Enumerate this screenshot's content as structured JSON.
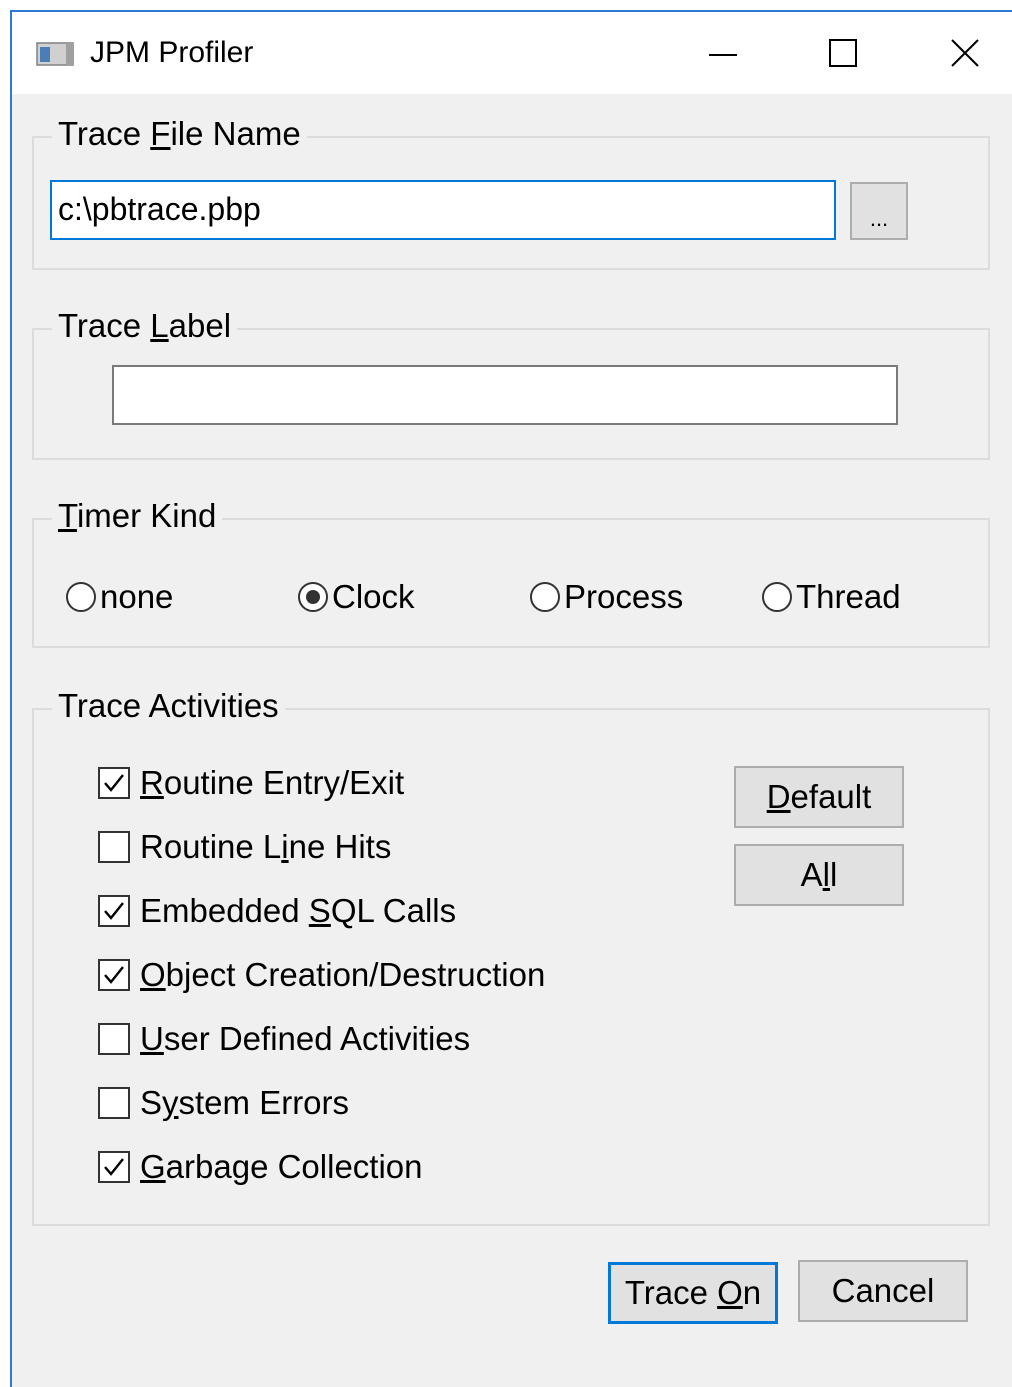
{
  "window": {
    "title": "JPM Profiler",
    "minimize_icon": "minimize-icon",
    "maximize_icon": "maximize-icon",
    "close_icon": "close-icon"
  },
  "trace_file": {
    "legend_pre": "Trace ",
    "legend_accel": "F",
    "legend_post": "ile Name",
    "value": "c:\\pbtrace.pbp",
    "browse_label": "..."
  },
  "trace_label": {
    "legend_pre": "Trace ",
    "legend_accel": "L",
    "legend_post": "abel",
    "value": ""
  },
  "timer_kind": {
    "legend_accel": "T",
    "legend_post": "imer Kind",
    "options": [
      {
        "label": "none",
        "selected": false
      },
      {
        "label": "Clock",
        "selected": true
      },
      {
        "label": "Process",
        "selected": false
      },
      {
        "label": "Thread",
        "selected": false
      }
    ]
  },
  "trace_activities": {
    "legend": "Trace Activities",
    "items": [
      {
        "pre": "",
        "accel": "R",
        "post": "outine Entry/Exit",
        "checked": true
      },
      {
        "pre": "Routine L",
        "accel": "i",
        "post": "ne Hits",
        "checked": false
      },
      {
        "pre": "Embedded ",
        "accel": "S",
        "post": "QL Calls",
        "checked": true
      },
      {
        "pre": "",
        "accel": "O",
        "post": "bject Creation/Destruction",
        "checked": true
      },
      {
        "pre": "",
        "accel": "U",
        "post": "ser Defined Activities",
        "checked": false
      },
      {
        "pre": "S",
        "accel": "y",
        "post": "stem Errors",
        "checked": false
      },
      {
        "pre": "",
        "accel": "G",
        "post": "arbage Collection",
        "checked": true
      }
    ],
    "default_button": {
      "pre": "",
      "accel": "D",
      "post": "efault"
    },
    "all_button": {
      "pre": "A",
      "accel": "l",
      "post": "l"
    }
  },
  "footer": {
    "trace_on": {
      "pre": "Trace ",
      "accel": "O",
      "post": "n"
    },
    "cancel_label": "Cancel"
  },
  "colors": {
    "accent": "#0078d7",
    "window_bg": "#f0f0f0",
    "button_bg": "#e1e1e1"
  }
}
